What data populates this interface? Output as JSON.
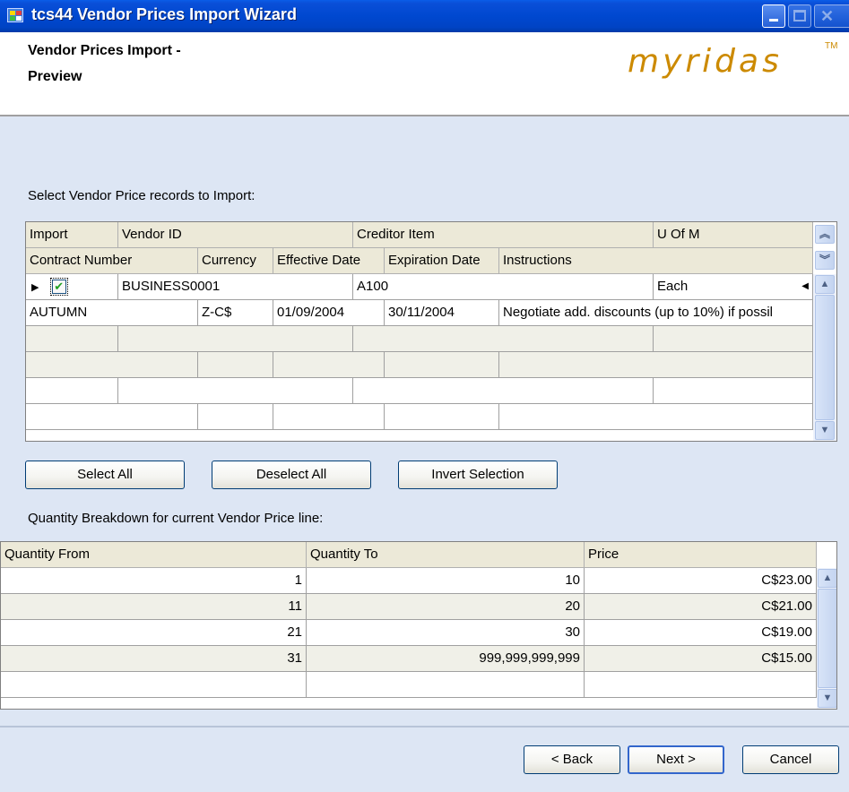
{
  "window": {
    "title": "tcs44 Vendor Prices Import Wizard"
  },
  "header": {
    "title_line1": "Vendor Prices Import -",
    "title_line2": "Preview",
    "logo": "myridas",
    "logo_tm": "TM"
  },
  "records": {
    "label": "Select Vendor Price records to Import:",
    "header_row1": {
      "import": "Import",
      "vendor_id": "Vendor ID",
      "creditor_item": "Creditor Item",
      "uom": "U Of M"
    },
    "header_row2": {
      "contract_number": "Contract Number",
      "currency": "Currency",
      "effective_date": "Effective Date",
      "expiration_date": "Expiration Date",
      "instructions": "Instructions"
    },
    "rows": [
      {
        "checked": true,
        "vendor_id": "BUSINESS0001",
        "creditor_item": "A100",
        "uom": "Each",
        "contract_number": "AUTUMN",
        "currency": "Z-C$",
        "effective_date": "01/09/2004",
        "expiration_date": "30/11/2004",
        "instructions": "Negotiate add. discounts (up to 10%) if possil"
      }
    ]
  },
  "buttons": {
    "select_all": "Select All",
    "deselect_all": "Deselect All",
    "invert_selection": "Invert Selection",
    "back": "< Back",
    "next": "Next >",
    "cancel": "Cancel"
  },
  "quantity": {
    "label": "Quantity Breakdown for current Vendor Price line:",
    "headers": {
      "from": "Quantity From",
      "to": "Quantity To",
      "price": "Price"
    },
    "rows": [
      {
        "from": "1",
        "to": "10",
        "price": "C$23.00"
      },
      {
        "from": "11",
        "to": "20",
        "price": "C$21.00"
      },
      {
        "from": "21",
        "to": "30",
        "price": "C$19.00"
      },
      {
        "from": "31",
        "to": "999,999,999,999",
        "price": "C$15.00"
      }
    ]
  },
  "icons": {
    "app": "wizard-app-icon",
    "row_indicator": "current-row-triangle",
    "check": "✔",
    "scroll_up": "▲",
    "scroll_down": "▼",
    "collapse": "double-chevron-up",
    "expand": "double-chevron-down"
  },
  "colors": {
    "titlebar": "#0048d0",
    "body": "#dde6f4",
    "logo": "#cc8a00"
  }
}
